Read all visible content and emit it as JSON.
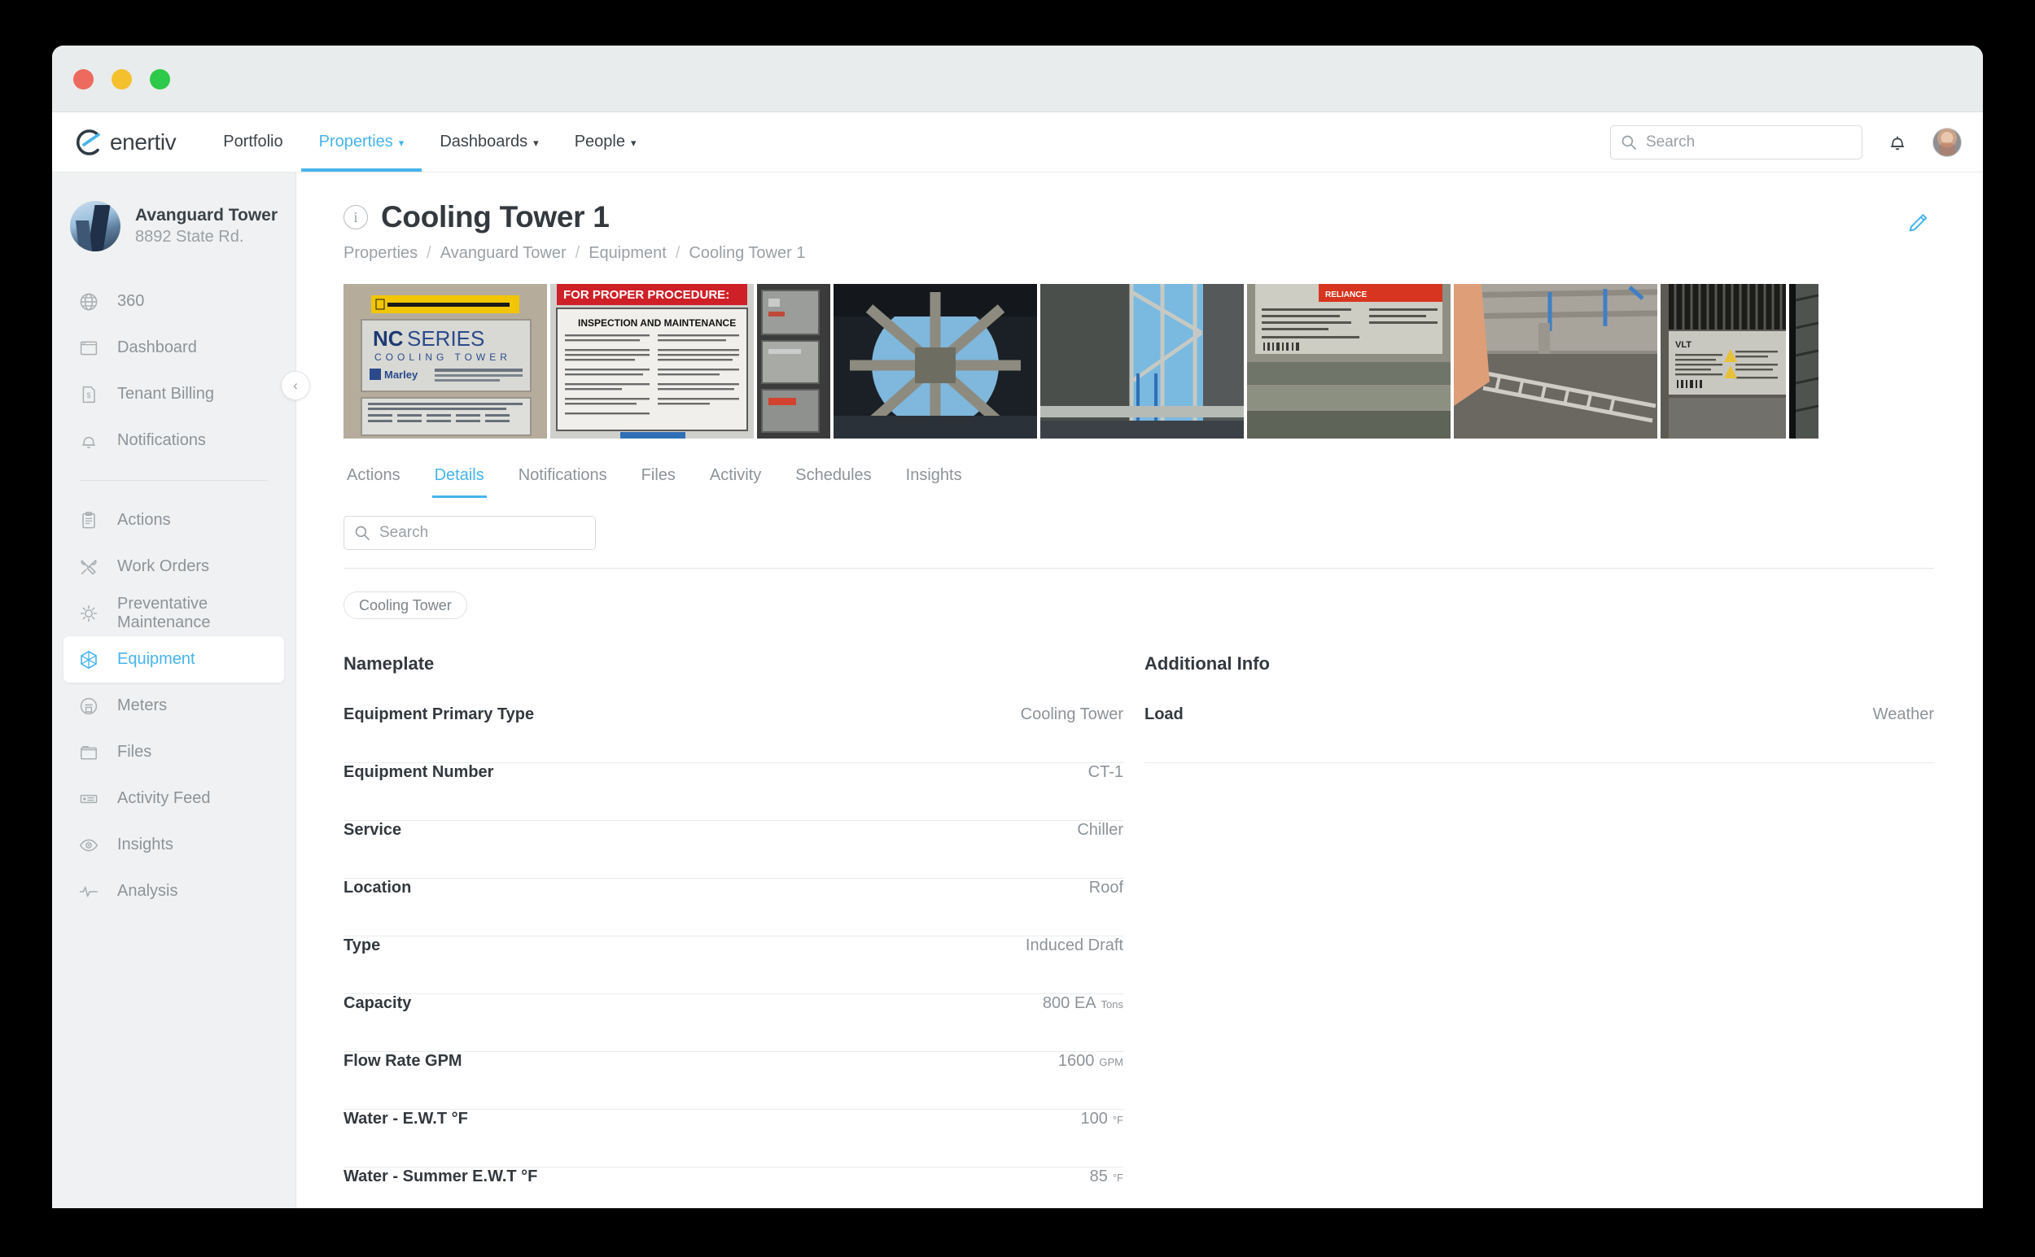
{
  "window": {
    "traffic_lights": [
      "close",
      "minimize",
      "zoom"
    ]
  },
  "topnav": {
    "brand": "enertiv",
    "items": [
      {
        "label": "Portfolio",
        "has_caret": false,
        "active": false
      },
      {
        "label": "Properties",
        "has_caret": true,
        "active": true
      },
      {
        "label": "Dashboards",
        "has_caret": true,
        "active": false
      },
      {
        "label": "People",
        "has_caret": true,
        "active": false
      }
    ],
    "search_placeholder": "Search",
    "search_value": "",
    "notifications_icon": "bell-icon",
    "avatar_icon": "user-avatar"
  },
  "sidebar": {
    "property": {
      "name": "Avanguard Tower",
      "address": "8892 State Rd."
    },
    "collapse_icon": "chevron-left-icon",
    "group_one": [
      {
        "label": "360",
        "icon": "globe-icon",
        "active": false
      },
      {
        "label": "Dashboard",
        "icon": "dashboard-icon",
        "active": false
      },
      {
        "label": "Tenant Billing",
        "icon": "invoice-dollar-icon",
        "active": false
      },
      {
        "label": "Notifications",
        "icon": "bell-icon",
        "active": false
      }
    ],
    "group_two": [
      {
        "label": "Actions",
        "icon": "clipboard-icon",
        "active": false
      },
      {
        "label": "Work Orders",
        "icon": "wrench-screwdriver-icon",
        "active": false
      },
      {
        "label": "Preventative Maintenance",
        "icon": "gear-icon",
        "active": false
      },
      {
        "label": "Equipment",
        "icon": "cube-icon",
        "active": true
      },
      {
        "label": "Meters",
        "icon": "meter-icon",
        "active": false
      },
      {
        "label": "Files",
        "icon": "folder-icon",
        "active": false
      },
      {
        "label": "Activity Feed",
        "icon": "feed-icon",
        "active": false
      },
      {
        "label": "Insights",
        "icon": "eye-icon",
        "active": false
      },
      {
        "label": "Analysis",
        "icon": "pulse-icon",
        "active": false
      }
    ]
  },
  "page": {
    "info_icon": "info-icon",
    "title": "Cooling Tower 1",
    "edit_icon": "pencil-icon",
    "breadcrumb": [
      "Properties",
      "Avanguard Tower",
      "Equipment",
      "Cooling Tower 1"
    ],
    "breadcrumb_separator": "/"
  },
  "photos": [
    {
      "name": "nameplate-nc-series-cooling-tower",
      "caption": "NC SERIES COOLING TOWER - Marley"
    },
    {
      "name": "inspection-and-maintenance-schedule-placard",
      "caption": "INSPECTION AND MAINTENANCE SCHEDULE"
    },
    {
      "name": "electrical-control-panels",
      "caption": "Electrical control panels"
    },
    {
      "name": "fan-deck-structure-from-below",
      "caption": "Fan deck structure from below"
    },
    {
      "name": "cooling-tower-exterior-frame",
      "caption": "Cooling tower exterior frame"
    },
    {
      "name": "motor-nameplate-closeup",
      "caption": "Motor nameplate close-up"
    },
    {
      "name": "rooftop-ladder-and-piping",
      "caption": "Rooftop ladder and piping"
    },
    {
      "name": "vlt-hvac-drive-nameplate",
      "caption": "VLT HVAC Drive nameplate"
    },
    {
      "name": "cooling-tower-louvers",
      "caption": "Cooling tower louvers"
    }
  ],
  "tabs": [
    {
      "label": "Actions",
      "active": false
    },
    {
      "label": "Details",
      "active": true
    },
    {
      "label": "Notifications",
      "active": false
    },
    {
      "label": "Files",
      "active": false
    },
    {
      "label": "Activity",
      "active": false
    },
    {
      "label": "Schedules",
      "active": false
    },
    {
      "label": "Insights",
      "active": false
    }
  ],
  "details": {
    "search_placeholder": "Search",
    "search_value": "",
    "chip": "Cooling Tower",
    "left": {
      "section_title": "Nameplate",
      "rows": [
        {
          "key": "Equipment Primary Type",
          "value": "Cooling Tower",
          "unit": ""
        },
        {
          "key": "Equipment Number",
          "value": "CT-1",
          "unit": ""
        },
        {
          "key": "Service",
          "value": "Chiller",
          "unit": ""
        },
        {
          "key": "Location",
          "value": "Roof",
          "unit": ""
        },
        {
          "key": "Type",
          "value": "Induced Draft",
          "unit": ""
        },
        {
          "key": "Capacity",
          "value": "800 EA",
          "unit": "Tons"
        },
        {
          "key": "Flow Rate GPM",
          "value": "1600",
          "unit": "GPM"
        },
        {
          "key": "Water - E.W.T °F",
          "value": "100",
          "unit": "°F"
        },
        {
          "key": "Water - Summer E.W.T °F",
          "value": "85",
          "unit": "°F"
        }
      ]
    },
    "right": {
      "section_title": "Additional Info",
      "rows": [
        {
          "key": "Load",
          "value": "Weather",
          "unit": ""
        }
      ]
    }
  },
  "colors": {
    "accent": "#46b4eb",
    "text_primary": "#33393e",
    "text_muted": "#8d9398",
    "sidebar_bg": "#f0f1f2",
    "border": "#e4e6e7"
  }
}
